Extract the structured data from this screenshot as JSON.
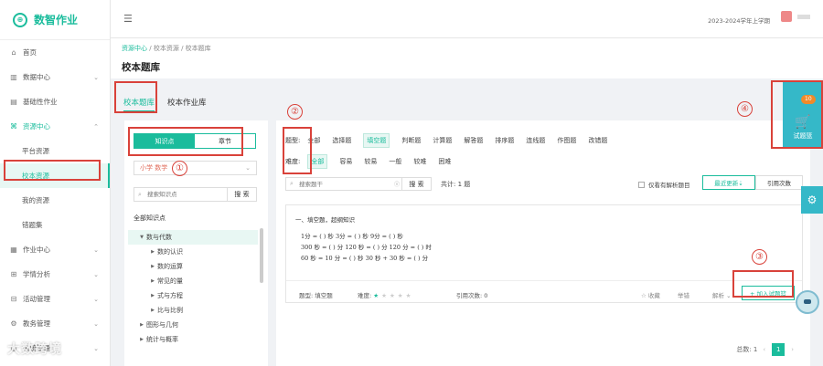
{
  "app": {
    "title": "数智作业"
  },
  "sidebar": {
    "items": [
      {
        "label": "首页",
        "icon": "home-icon",
        "chev": ""
      },
      {
        "label": "数据中心",
        "icon": "chart-icon",
        "chev": "⌄"
      },
      {
        "label": "基础性作业",
        "icon": "doc-icon",
        "chev": ""
      },
      {
        "label": "资源中心",
        "icon": "resource-icon",
        "chev": "⌃"
      }
    ],
    "sub_items": [
      {
        "label": "平台资源"
      },
      {
        "label": "校本资源"
      },
      {
        "label": "我的资源"
      },
      {
        "label": "错题集"
      }
    ],
    "items2": [
      {
        "label": "作业中心",
        "icon": "calendar-icon",
        "chev": "⌄"
      },
      {
        "label": "学情分析",
        "icon": "analysis-icon",
        "chev": "⌄"
      },
      {
        "label": "活动管理",
        "icon": "gift-icon",
        "chev": "⌄"
      },
      {
        "label": "教务管理",
        "icon": "settings-icon",
        "chev": "⌄"
      },
      {
        "label": "系统管理",
        "icon": "system-icon",
        "chev": "⌄"
      }
    ]
  },
  "topbar": {
    "term": "2023-2024学年上学期"
  },
  "breadcrumb": {
    "home": "资源中心",
    "sep1": "/",
    "level2": "校本资源",
    "sep2": "/",
    "level3": "校本题库"
  },
  "page_title": "校本题库",
  "tabs": [
    {
      "label": "校本题库"
    },
    {
      "label": "校本作业库"
    }
  ],
  "left": {
    "toggle": {
      "on": "知识点",
      "off": "章节"
    },
    "select_value": "小学 数学",
    "search_placeholder": "搜索知识点",
    "search_button": "搜 索",
    "tree_all": "全部知识点",
    "tree": [
      {
        "label": "数与代数",
        "level": 1,
        "sel": true
      },
      {
        "label": "数的认识",
        "level": 2
      },
      {
        "label": "数的运算",
        "level": 2
      },
      {
        "label": "常见的量",
        "level": 2
      },
      {
        "label": "式与方程",
        "level": 2
      },
      {
        "label": "比与比例",
        "level": 2
      },
      {
        "label": "图形与几何",
        "level": 1
      },
      {
        "label": "统计与概率",
        "level": 1
      }
    ]
  },
  "filters": {
    "type_label": "题型:",
    "types": [
      "全部",
      "选择题",
      "填空题",
      "判断题",
      "计算题",
      "解答题",
      "排序题",
      "连线题",
      "作图题",
      "改错题"
    ],
    "type_selected": "填空题",
    "diff_label": "难度:",
    "diffs": [
      "全部",
      "容易",
      "较易",
      "一般",
      "较难",
      "困难"
    ],
    "diff_selected": "全部"
  },
  "search": {
    "placeholder": "搜索题干",
    "clear": "ⓧ",
    "button": "搜 索",
    "total": "共计: 1 题"
  },
  "only_analysis": "仅看有解析题目",
  "sort": {
    "latest": "最近更新⇣",
    "usage": "引用次数"
  },
  "question": {
    "title": "一、填空题，超纲知识",
    "lines": [
      "1分 = ( ) 秒 3分 = ( ) 秒 9分 = ( ) 秒",
      "300 秒 = ( ) 分 120 秒 = ( ) 分 120 分 = ( ) 时",
      "60 秒 = 10 分 = ( ) 秒 30 秒 + 30 秒 = ( ) 分"
    ],
    "type": "题型: 填空题",
    "difficulty_label": "难度:",
    "stars_filled": 1,
    "stars_total": 5,
    "usage": "引用次数: 0",
    "collect": "☆ 收藏",
    "similar": "举错",
    "analysis": "解析 ⌄",
    "add": "+ 加入试题篮"
  },
  "pagination": {
    "total": "总数: 1",
    "page": "1",
    "prev": "‹",
    "next": "›"
  },
  "cart": {
    "badge": "10",
    "label": "试题篮"
  },
  "annotations": [
    "①",
    "②",
    "③",
    "④"
  ],
  "watermark": "大数跨境",
  "colors": {
    "accent": "#1abc9c",
    "annotation": "#d9423a",
    "cart": "#35b8c8",
    "badge": "#f08a2a"
  }
}
